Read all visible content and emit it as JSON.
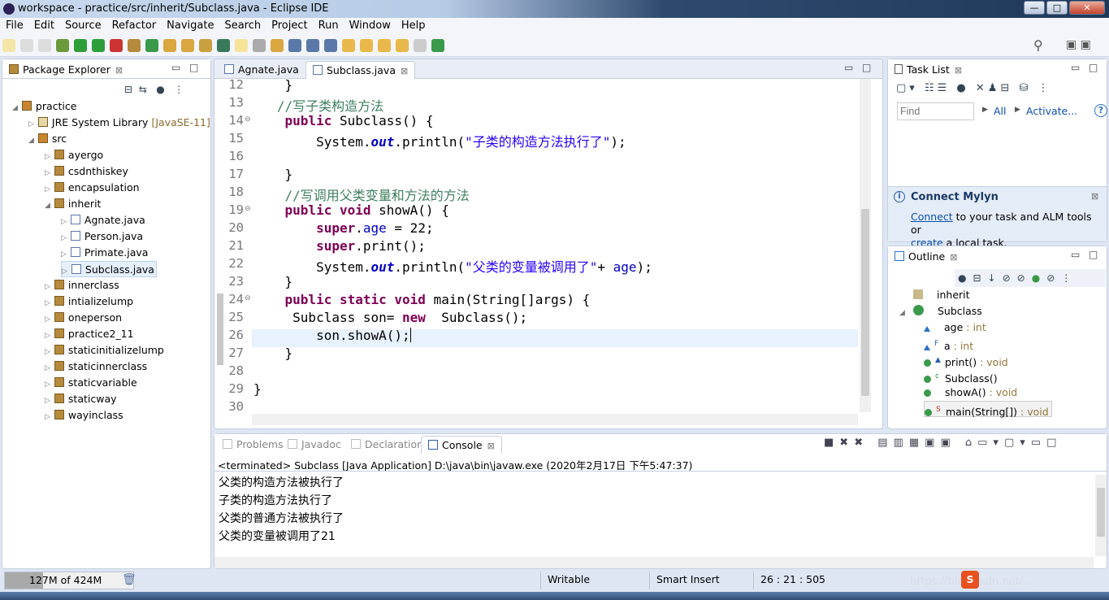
{
  "window": {
    "title": "workspace - practice/src/inherit/Subclass.java - Eclipse IDE",
    "min": "—",
    "max": "□",
    "close": "✕"
  },
  "menu": [
    "File",
    "Edit",
    "Source",
    "Refactor",
    "Navigate",
    "Search",
    "Project",
    "Run",
    "Window",
    "Help"
  ],
  "package_explorer": {
    "title": "Package Explorer",
    "tree": [
      {
        "label": "practice",
        "level": 0,
        "icon": "project",
        "open": true
      },
      {
        "label": "JRE System Library",
        "extra": " [JavaSE-11]",
        "level": 1,
        "icon": "library"
      },
      {
        "label": "src",
        "level": 1,
        "icon": "source-folder",
        "open": true
      },
      {
        "label": "ayergo",
        "level": 2,
        "icon": "package"
      },
      {
        "label": "csdnthiskey",
        "level": 2,
        "icon": "package"
      },
      {
        "label": "encapsulation",
        "level": 2,
        "icon": "package"
      },
      {
        "label": "inherit",
        "level": 2,
        "icon": "package",
        "open": true
      },
      {
        "label": "Agnate.java",
        "level": 3,
        "icon": "java-file"
      },
      {
        "label": "Person.java",
        "level": 3,
        "icon": "java-file"
      },
      {
        "label": "Primate.java",
        "level": 3,
        "icon": "java-file"
      },
      {
        "label": "Subclass.java",
        "level": 3,
        "icon": "java-file",
        "selected": true
      },
      {
        "label": "innerclass",
        "level": 2,
        "icon": "package"
      },
      {
        "label": "intializelump",
        "level": 2,
        "icon": "package"
      },
      {
        "label": "oneperson",
        "level": 2,
        "icon": "package"
      },
      {
        "label": "practice2_11",
        "level": 2,
        "icon": "package"
      },
      {
        "label": "staticinitializelump",
        "level": 2,
        "icon": "package"
      },
      {
        "label": "staticinnerclass",
        "level": 2,
        "icon": "package"
      },
      {
        "label": "staticvariable",
        "level": 2,
        "icon": "package"
      },
      {
        "label": "staticway",
        "level": 2,
        "icon": "package"
      },
      {
        "label": "wayinclass",
        "level": 2,
        "icon": "package"
      }
    ]
  },
  "editor": {
    "tabs": [
      {
        "label": "Agnate.java",
        "active": false
      },
      {
        "label": "Subclass.java",
        "active": true
      }
    ],
    "current_line": 26,
    "lines": [
      {
        "n": "12",
        "t": [
          [
            "plain",
            "    }"
          ]
        ]
      },
      {
        "n": "13",
        "t": [
          [
            "cm",
            "   //写子类构造方法"
          ]
        ]
      },
      {
        "n": "14",
        "t": [
          [
            "plain",
            "    "
          ],
          [
            "kw",
            "public"
          ],
          [
            "plain",
            " Subclass() {"
          ]
        ],
        "fold": true
      },
      {
        "n": "15",
        "t": [
          [
            "plain",
            "        System."
          ],
          [
            "sf",
            "out"
          ],
          [
            "plain",
            ".println("
          ],
          [
            "st",
            "\"子类的构造方法执行了\""
          ],
          [
            "plain",
            ");"
          ]
        ]
      },
      {
        "n": "16",
        "t": [
          [
            "plain",
            ""
          ]
        ]
      },
      {
        "n": "17",
        "t": [
          [
            "plain",
            "    }"
          ]
        ]
      },
      {
        "n": "18",
        "t": [
          [
            "cm",
            "    //写调用父类变量和方法的方法"
          ]
        ]
      },
      {
        "n": "19",
        "t": [
          [
            "plain",
            "    "
          ],
          [
            "kw",
            "public"
          ],
          [
            "plain",
            " "
          ],
          [
            "kw",
            "void"
          ],
          [
            "plain",
            " showA() {"
          ]
        ],
        "fold": true
      },
      {
        "n": "20",
        "t": [
          [
            "plain",
            "        "
          ],
          [
            "kw",
            "super"
          ],
          [
            "plain",
            "."
          ],
          [
            "fd",
            "age"
          ],
          [
            "plain",
            " = 22;"
          ]
        ]
      },
      {
        "n": "21",
        "t": [
          [
            "plain",
            "        "
          ],
          [
            "kw",
            "super"
          ],
          [
            "plain",
            ".print();"
          ]
        ]
      },
      {
        "n": "22",
        "t": [
          [
            "plain",
            "        System."
          ],
          [
            "sf",
            "out"
          ],
          [
            "plain",
            ".println("
          ],
          [
            "st",
            "\"父类的变量被调用了\""
          ],
          [
            "plain",
            "+ "
          ],
          [
            "fd",
            "age"
          ],
          [
            "plain",
            ");"
          ]
        ]
      },
      {
        "n": "23",
        "t": [
          [
            "plain",
            "    }"
          ]
        ]
      },
      {
        "n": "24",
        "t": [
          [
            "plain",
            "    "
          ],
          [
            "kw",
            "public"
          ],
          [
            "plain",
            " "
          ],
          [
            "kw",
            "static"
          ],
          [
            "plain",
            " "
          ],
          [
            "kw",
            "void"
          ],
          [
            "plain",
            " main(String[]args) {"
          ]
        ],
        "fold": true
      },
      {
        "n": "25",
        "t": [
          [
            "plain",
            "     Subclass son= "
          ],
          [
            "kw",
            "new"
          ],
          [
            "plain",
            "  Subclass();"
          ]
        ]
      },
      {
        "n": "26",
        "t": [
          [
            "plain",
            "        son.showA();"
          ]
        ]
      },
      {
        "n": "27",
        "t": [
          [
            "plain",
            "    }"
          ]
        ]
      },
      {
        "n": "28",
        "t": [
          [
            "plain",
            ""
          ]
        ]
      },
      {
        "n": "29",
        "t": [
          [
            "plain",
            "}"
          ]
        ]
      },
      {
        "n": "30",
        "t": [
          [
            "plain",
            ""
          ]
        ]
      }
    ]
  },
  "task_list": {
    "title": "Task List",
    "find_placeholder": "Find",
    "all": "All",
    "activate": "Activate...",
    "help": "?"
  },
  "mylyn": {
    "title": "Connect Mylyn",
    "connect": "Connect",
    "text1": " to your task and ALM tools or",
    "create": "create",
    "text2": " a local task."
  },
  "outline": {
    "title": "Outline",
    "items": [
      {
        "label": "inherit",
        "type": "",
        "level": 0,
        "icon": "package"
      },
      {
        "label": "Subclass",
        "type": "",
        "level": 0,
        "icon": "class",
        "open": true
      },
      {
        "label": "age",
        "type": " : int",
        "level": 1,
        "icon": "field-default",
        "mark": ""
      },
      {
        "label": "a",
        "type": " : int",
        "level": 1,
        "icon": "field-default",
        "mark": "F"
      },
      {
        "label": "print()",
        "type": " : void",
        "level": 1,
        "icon": "method-public",
        "mark": "▲"
      },
      {
        "label": "Subclass()",
        "type": "",
        "level": 1,
        "icon": "method-public",
        "mark": "c"
      },
      {
        "label": "showA()",
        "type": " : void",
        "level": 1,
        "icon": "method-public",
        "mark": ""
      },
      {
        "label": "main(String[])",
        "type": " : void",
        "level": 1,
        "icon": "method-public",
        "mark": "S",
        "selected": true
      }
    ]
  },
  "bottom": {
    "tabs": [
      {
        "label": "Problems",
        "active": false
      },
      {
        "label": "Javadoc",
        "active": false
      },
      {
        "label": "Declaration",
        "active": false
      },
      {
        "label": "Console",
        "active": true
      }
    ],
    "console_header": "<terminated> Subclass [Java Application] D:\\java\\bin\\javaw.exe (2020年2月17日 下午5:47:37)",
    "output": [
      "父类的构造方法被执行了",
      "子类的构造方法执行了",
      "父类的普通方法被执行了",
      "父类的变量被调用了21"
    ]
  },
  "status": {
    "heap": "127M of 424M",
    "heap_used_fraction": 0.3,
    "writable": "Writable",
    "insert_mode": "Smart Insert",
    "position": "26 : 21 : 505",
    "watermark": "https://blog.csdn.net/..."
  },
  "colors": {
    "keyword": "#7f0055",
    "comment": "#3f7f5f",
    "string": "#2a00ff",
    "field": "#0000c0",
    "current_line": "#e8f2fe"
  }
}
